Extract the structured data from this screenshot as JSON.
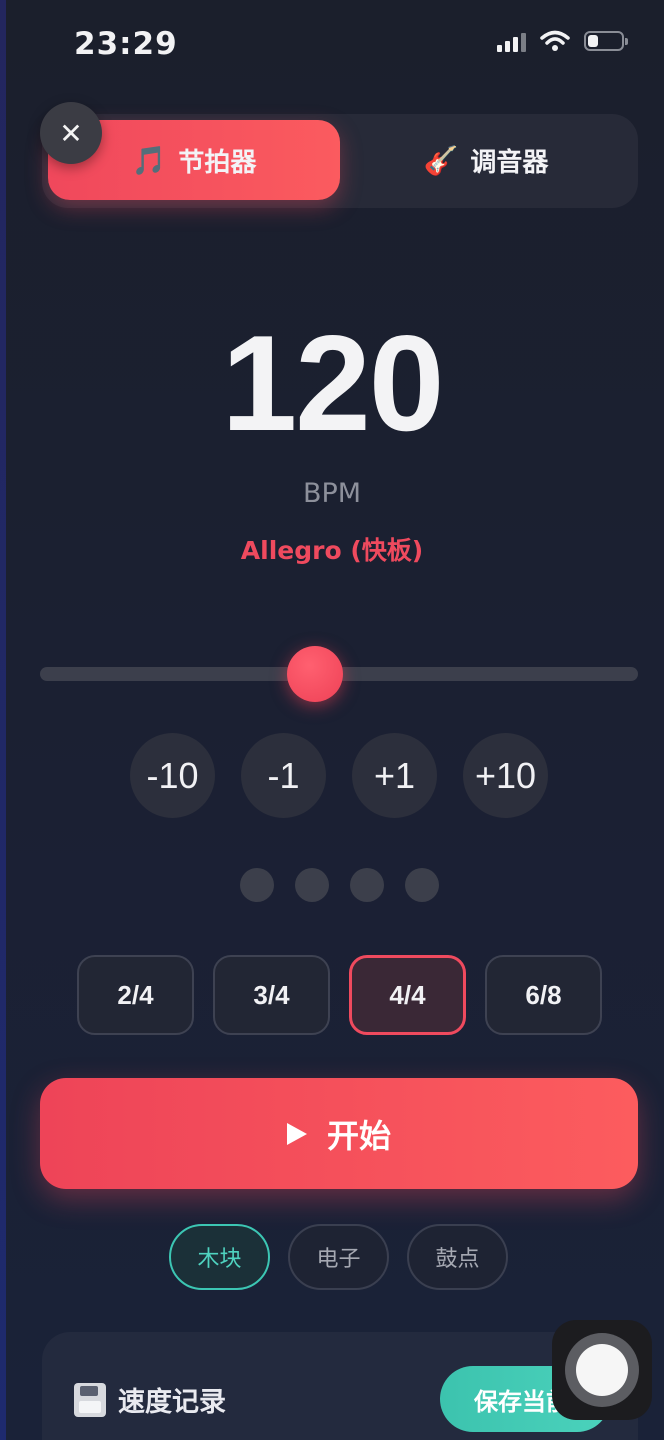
{
  "status_bar": {
    "time": "23:29",
    "battery_level": 0.3
  },
  "tabs": [
    {
      "label": "节拍器",
      "icon": "music-note-icon",
      "icon_glyph": "🎵",
      "active": true
    },
    {
      "label": "调音器",
      "icon": "guitar-icon",
      "icon_glyph": "🎸",
      "active": false
    }
  ],
  "close_glyph": "✕",
  "tempo": {
    "bpm": "120",
    "unit": "BPM",
    "name": "Allegro (快板)",
    "slider_fraction": 0.46
  },
  "step_buttons": [
    "-10",
    "-1",
    "+1",
    "+10"
  ],
  "beat_count": 4,
  "time_signatures": {
    "options": [
      "2/4",
      "3/4",
      "4/4",
      "6/8"
    ],
    "selected": "4/4"
  },
  "start_button": {
    "label": "开始",
    "icon": "play-icon"
  },
  "sounds": {
    "options": [
      "木块",
      "电子",
      "鼓点"
    ],
    "selected": "木块"
  },
  "record_card": {
    "title": "速度记录",
    "icon": "floppy-disk-icon",
    "save_label": "保存当前"
  },
  "colors": {
    "accent": "#ef4a5e",
    "teal": "#3cc6b3",
    "background": "#1b1f2c"
  }
}
